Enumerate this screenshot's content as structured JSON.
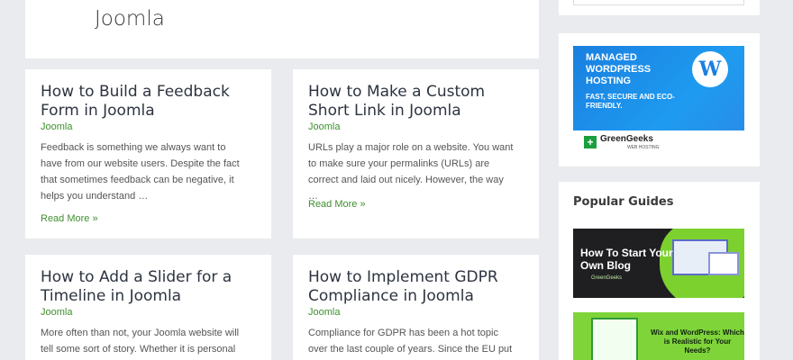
{
  "header": {
    "title": "Joomla"
  },
  "posts": [
    {
      "title": "How to Build a Feedback Form in Joomla",
      "category": "Joomla",
      "excerpt": "Feedback is something we always want to have from our website users. Despite the fact that sometimes feedback can be negative, it helps you understand …",
      "read_more": "Read More »"
    },
    {
      "title": "How to Make a Custom Short Link in Joomla",
      "category": "Joomla",
      "excerpt": "URLs play a major role on a website. You want to make sure your permalinks (URLs) are correct and laid out nicely. However, the way …",
      "read_more": "Read More »"
    },
    {
      "title": "How to Add a Slider for a Timeline in Joomla",
      "category": "Joomla",
      "excerpt": "More often than not, your Joomla website will tell some sort of story. Whether it is personal"
    },
    {
      "title": "How to Implement GDPR Compliance in Joomla",
      "category": "Joomla",
      "excerpt": "Compliance for GDPR has been a hot topic over the last couple of years. Since the EU put"
    }
  ],
  "sidebar": {
    "ad": {
      "headline": "MANAGED WORDPRESS HOSTING",
      "subline": "FAST, SECURE AND ECO-FRIENDLY.",
      "badge": "W",
      "brand": "GreenGeeks",
      "brand_tag": "WEB HOSTING",
      "logo_glyph": "+"
    },
    "popular_guides": {
      "title": "Popular Guides",
      "items": [
        {
          "title": "How To Start Your Own Blog",
          "brand": "GreenGeeks"
        },
        {
          "title": "Wix and WordPress: Which is Realistic for Your Needs?"
        }
      ]
    }
  },
  "colors": {
    "accent_green": "#3f8f2f",
    "page_bg": "#e9ebef",
    "ad_blue": "#1e9bf0"
  }
}
